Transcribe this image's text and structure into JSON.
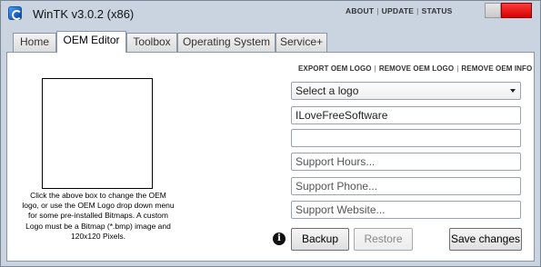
{
  "window": {
    "title": "WinTK v3.0.2 (x86)",
    "top_links": [
      "ABOUT",
      "UPDATE",
      "STATUS"
    ]
  },
  "tabs": [
    {
      "label": "Home",
      "active": false
    },
    {
      "label": "OEM Editor",
      "active": true
    },
    {
      "label": "Toolbox",
      "active": false
    },
    {
      "label": "Operating System",
      "active": false
    },
    {
      "label": "Service+",
      "active": false
    }
  ],
  "oem": {
    "actions": [
      "EXPORT OEM LOGO",
      "REMOVE OEM LOGO",
      "REMOVE OEM INFO"
    ],
    "logo_help": "Click the above box to change the OEM logo, or use the OEM Logo drop down menu for some pre-installed Bitmaps. A custom Logo must be a Bitmap (*.bmp) image and 120x120 Pixels.",
    "logo_select": "Select a logo",
    "manufacturer": "ILoveFreeSoftware",
    "model": "",
    "support_hours": "Support Hours...",
    "support_phone": "Support Phone...",
    "support_website": "Support Website...",
    "info_icon": "i",
    "buttons": {
      "backup": "Backup",
      "restore": "Restore",
      "save": "Save changes"
    }
  },
  "colors": {
    "window_bg": "#c9d4e0",
    "close_button": "#e00000"
  },
  "icons": {
    "app": "app-icon",
    "info": "info-icon",
    "dropdown": "chevron-down-icon"
  }
}
